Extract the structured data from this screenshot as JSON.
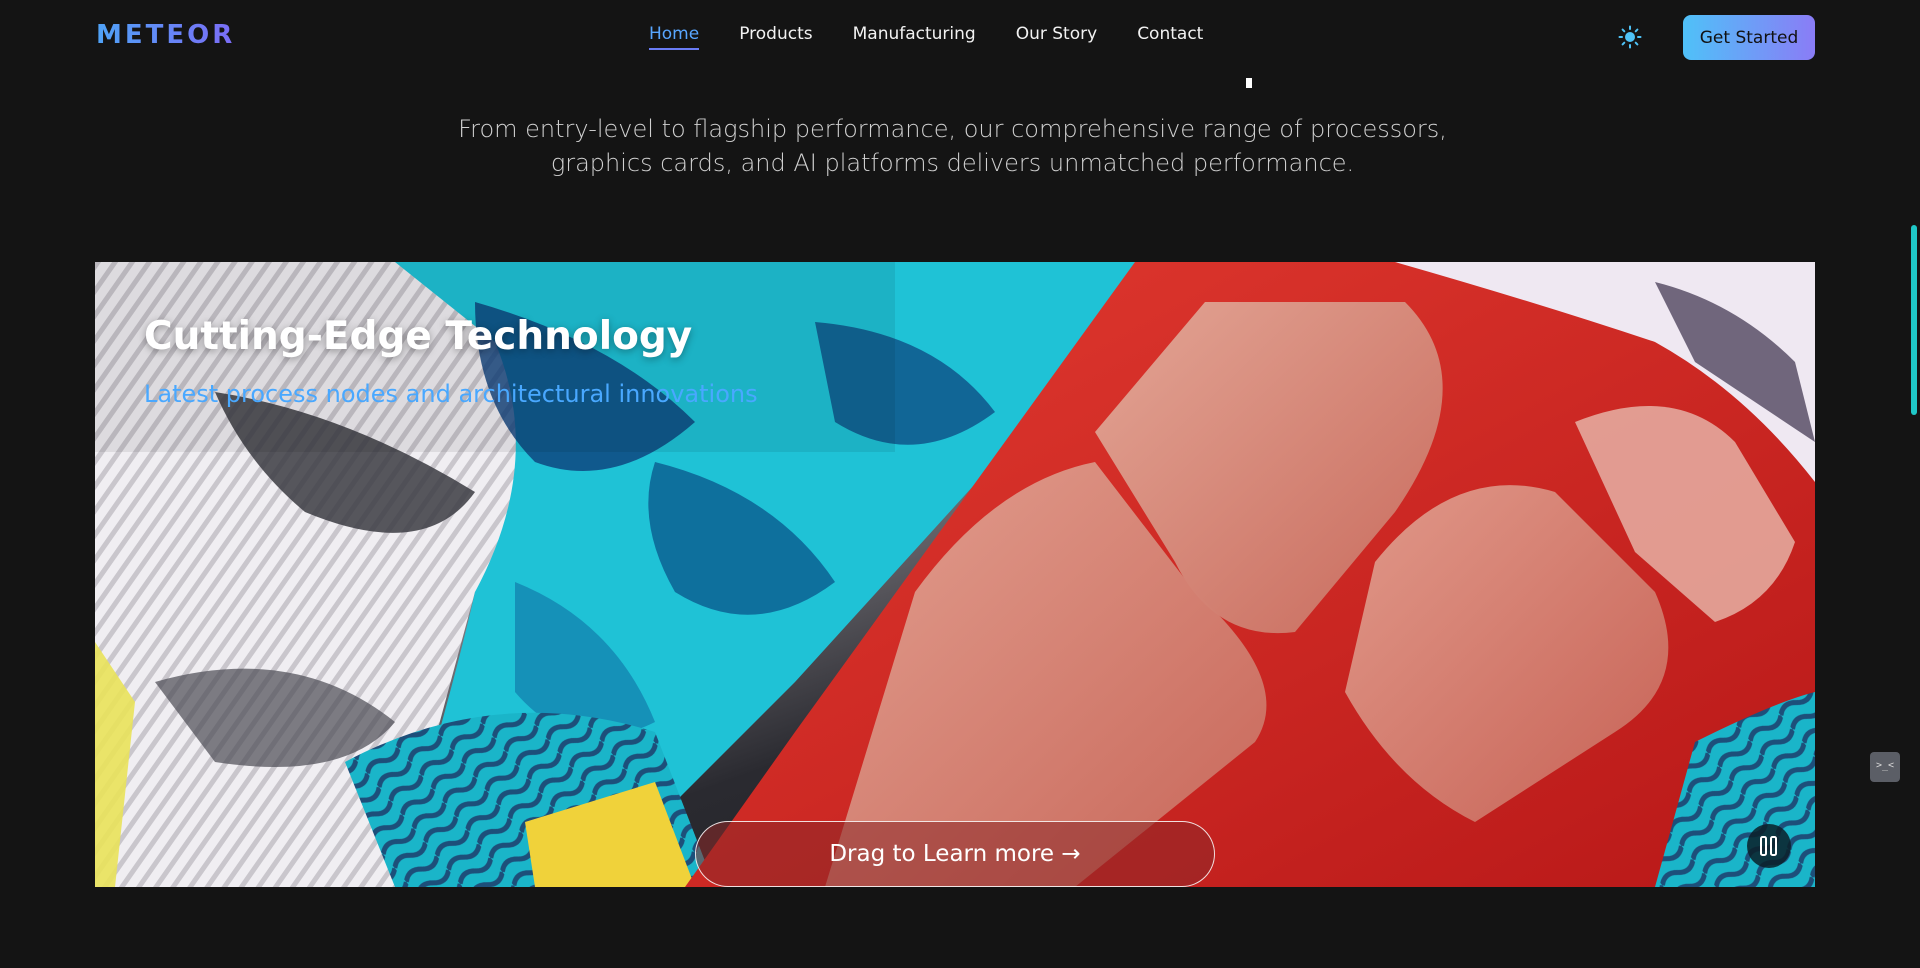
{
  "brand": {
    "logo": "METEOR"
  },
  "nav": {
    "items": [
      {
        "label": "Home",
        "active": true
      },
      {
        "label": "Products",
        "active": false
      },
      {
        "label": "Manufacturing",
        "active": false
      },
      {
        "label": "Our Story",
        "active": false
      },
      {
        "label": "Contact",
        "active": false
      }
    ]
  },
  "header": {
    "theme_toggle_icon": "sun-icon",
    "cta_label": "Get Started"
  },
  "intro": {
    "line1": "From entry-level to flagship performance, our comprehensive range of processors,",
    "line2": "graphics cards, and AI platforms delivers unmatched performance."
  },
  "hero": {
    "title": "Cutting-Edge Technology",
    "subtitle": "Latest process nodes and architectural innovations",
    "drag_label": "Drag to Learn more →",
    "pause_icon": "pause-icon"
  },
  "widget": {
    "label": ">_<"
  },
  "colors": {
    "background": "#141414",
    "accent_blue": "#58a6ff",
    "accent_purple": "#7b6cf6",
    "cta_gradient_start": "#4fc1f8",
    "cta_gradient_end": "#8a7cf6",
    "scroll_accent": "#1fc7c7"
  }
}
